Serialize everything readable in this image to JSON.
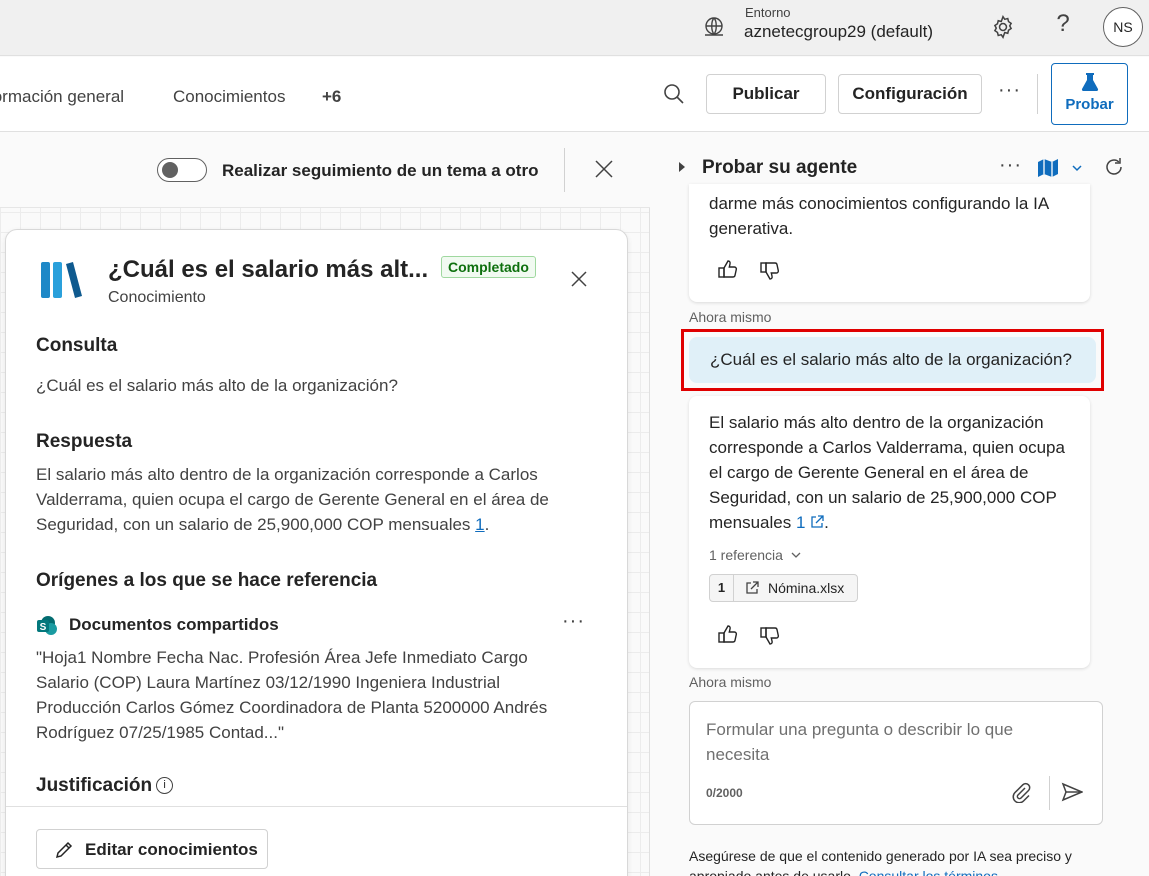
{
  "topbar": {
    "env_label": "Entorno",
    "env_value": "aznetecgroup29 (default)",
    "help": "?",
    "avatar_initials": "NS"
  },
  "nav": {
    "tabs": [
      "formación general",
      "Conocimientos",
      "+6"
    ],
    "publish_label": "Publicar",
    "config_label": "Configuración",
    "more": "···",
    "test_label": "Probar"
  },
  "left": {
    "toggle_label": "Realizar seguimiento de un tema a otro",
    "toggle_on": false,
    "card": {
      "title": "¿Cuál es el salario más alt...",
      "subtitle": "Conocimiento",
      "badge": "Completado",
      "query_heading": "Consulta",
      "query_text": "¿Cuál es el salario más alto de la organización?",
      "answer_heading": "Respuesta",
      "answer_text": "El salario más alto dentro de la organización corresponde a Carlos Valderrama, quien ocupa el cargo de Gerente General en el área de Seguridad, con un salario de 25,900,000 COP mensuales ",
      "answer_cite": "1",
      "answer_end": ".",
      "sources_heading": "Orígenes a los que se hace referencia",
      "source_name": "Documentos compartidos",
      "source_more": "···",
      "source_excerpt": "\"Hoja1 Nombre Fecha Nac. Profesión Área Jefe Inmediato Cargo Salario (COP) Laura Martínez 03/12/1990 Ingeniera Industrial Producción Carlos Gómez Coordinadora de Planta 5200000 Andrés Rodríguez 07/25/1985 Contad...\"",
      "justification_heading": "Justificación",
      "edit_label": "Editar conocimientos"
    }
  },
  "right": {
    "title": "Probar su agente",
    "more": "···",
    "prev_bot_text": "darme más conocimientos configurando la IA generativa.",
    "timestamp_1": "Ahora mismo",
    "user_message": "¿Cuál es el salario más alto de la organización?",
    "bot_text": "El salario más alto dentro de la organización corresponde a Carlos Valderrama, quien ocupa el cargo de Gerente General en el área de Seguridad, con un salario de 25,900,000 COP mensuales ",
    "bot_cite": "1",
    "bot_end": ".",
    "references_toggle": "1 referencia",
    "reference": {
      "num": "1",
      "name": "Nómina.xlsx"
    },
    "timestamp_2": "Ahora mismo",
    "composer_placeholder": "Formular una pregunta o describir lo que necesita",
    "counter": "0/2000",
    "disclaimer": "Asegúrese de que el contenido generado por IA sea preciso y apropiado antes de usarlo.",
    "disclaimer_link": "Consultar los términos"
  },
  "colors": {
    "accent": "#0f6cbd",
    "user_bubble": "#e0f0f8",
    "highlight": "#e00000",
    "badge_green": "#0e700e"
  },
  "icons": [
    "globe-icon",
    "gear-icon",
    "search-icon",
    "flask-icon",
    "close-icon",
    "knowledge-books-icon",
    "sharepoint-icon",
    "info-icon",
    "pencil-icon",
    "caret-right-icon",
    "map-icon",
    "chevron-down-icon",
    "refresh-icon",
    "thumbs-up-icon",
    "thumbs-down-icon",
    "external-link-icon",
    "paperclip-icon",
    "send-icon"
  ]
}
